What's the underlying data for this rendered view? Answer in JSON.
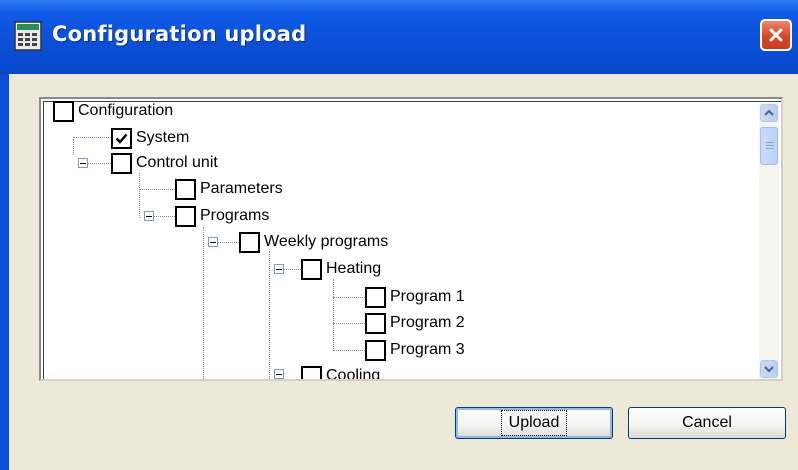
{
  "window": {
    "title": "Configuration upload",
    "icon": "app-config-icon",
    "close_icon": "close-icon"
  },
  "tree": {
    "nodes": [
      {
        "label": "Configuration",
        "checked": false
      },
      {
        "label": "System",
        "checked": true
      },
      {
        "label": "Control unit",
        "checked": false
      },
      {
        "label": "Parameters",
        "checked": false
      },
      {
        "label": "Programs",
        "checked": false
      },
      {
        "label": "Weekly programs",
        "checked": false
      },
      {
        "label": "Heating",
        "checked": false
      },
      {
        "label": "Program 1",
        "checked": false
      },
      {
        "label": "Program 2",
        "checked": false
      },
      {
        "label": "Program 3",
        "checked": false
      },
      {
        "label": "Cooling",
        "checked": false
      }
    ]
  },
  "scrollbar": {
    "up_icon": "chevron-up-icon",
    "down_icon": "chevron-down-icon"
  },
  "buttons": {
    "upload": "Upload",
    "cancel": "Cancel"
  },
  "colors": {
    "titlebar": "#0a4fd6",
    "client_bg": "#ece9d8",
    "close_button": "#d9462a"
  }
}
